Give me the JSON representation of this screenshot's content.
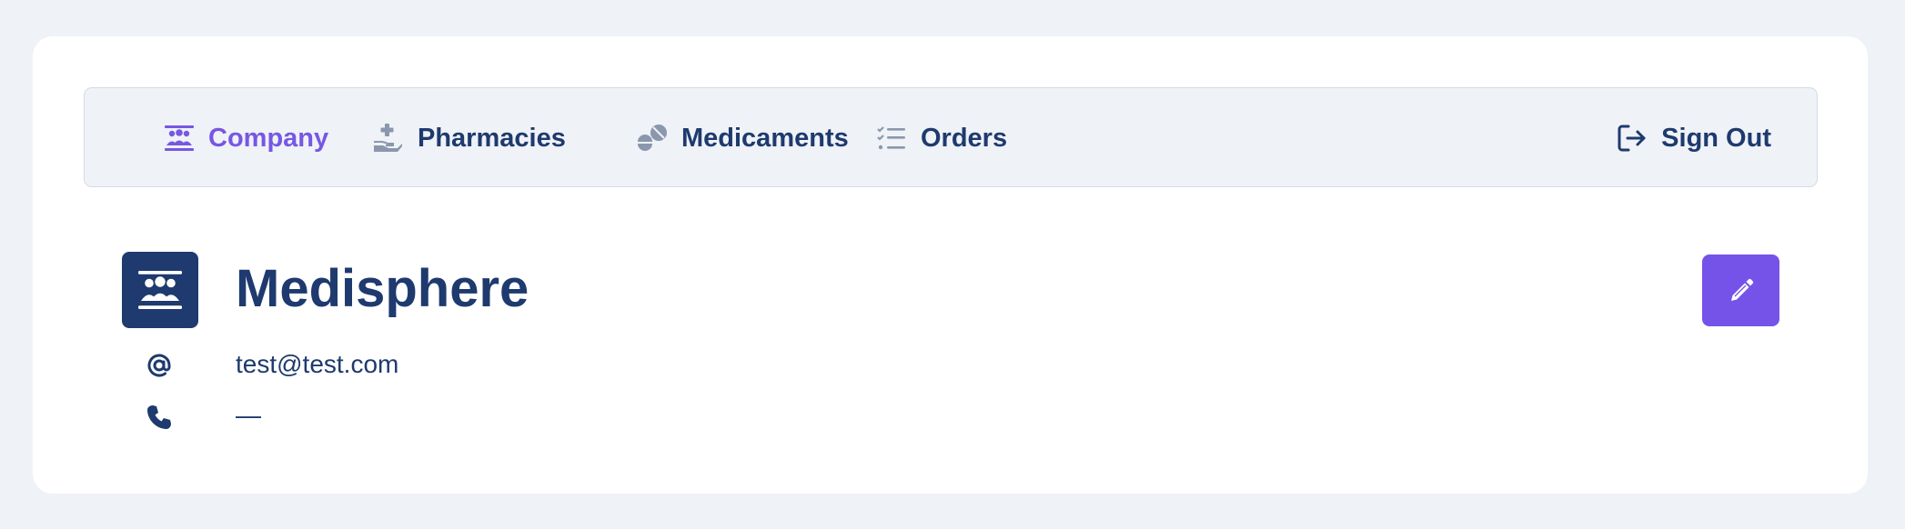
{
  "nav": {
    "items": [
      {
        "label": "Company",
        "icon": "company-icon",
        "active": true
      },
      {
        "label": "Pharmacies",
        "icon": "pharmacy-icon",
        "active": false
      },
      {
        "label": "Medicaments",
        "icon": "pills-icon",
        "active": false
      },
      {
        "label": "Orders",
        "icon": "list-check-icon",
        "active": false
      }
    ],
    "signout_label": "Sign Out"
  },
  "company": {
    "name": "Medisphere",
    "email": "test@test.com",
    "phone": "—"
  },
  "colors": {
    "primary": "#1e3a6e",
    "accent": "#7553e8",
    "background": "#eff2f7",
    "card": "#ffffff"
  }
}
